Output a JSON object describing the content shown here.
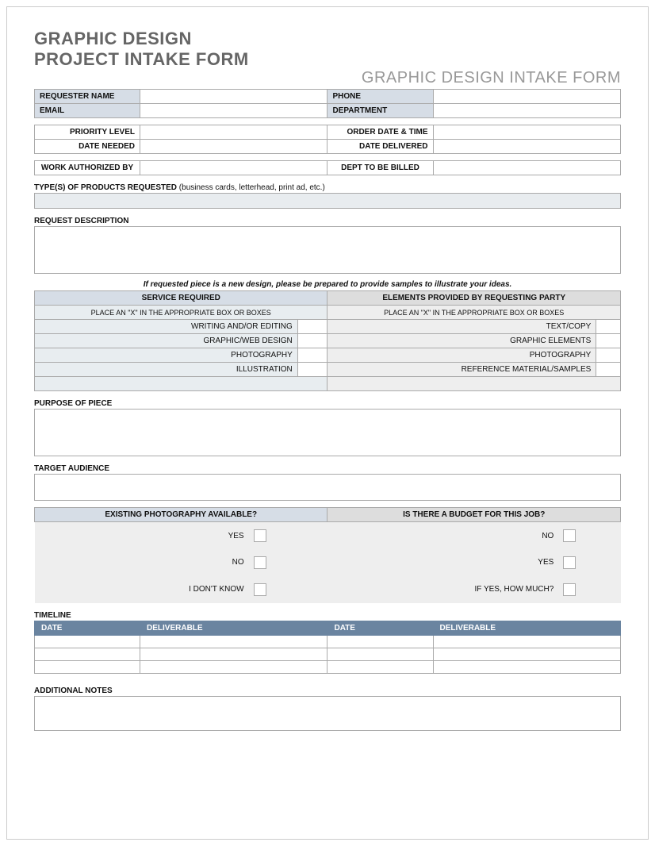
{
  "title_line1": "GRAPHIC DESIGN",
  "title_line2": "PROJECT INTAKE FORM",
  "header_right": "GRAPHIC DESIGN INTAKE FORM",
  "fields": {
    "requester_name": "REQUESTER NAME",
    "phone": "PHONE",
    "email": "EMAIL",
    "department": "DEPARTMENT",
    "priority_level": "PRIORITY LEVEL",
    "order_date_time": "ORDER DATE & TIME",
    "date_needed": "DATE NEEDED",
    "date_delivered": "DATE DELIVERED",
    "work_authorized_by": "WORK AUTHORIZED BY",
    "dept_to_be_billed": "DEPT TO BE BILLED"
  },
  "products": {
    "label": "TYPE(S) OF PRODUCTS REQUESTED",
    "hint": "(business cards, letterhead, print ad, etc.)"
  },
  "request_description": "REQUEST DESCRIPTION",
  "note": "If requested piece is a new design, please be prepared to provide samples to illustrate your ideas.",
  "service": {
    "header_left": "SERVICE REQUIRED",
    "header_right": "ELEMENTS PROVIDED BY REQUESTING PARTY",
    "instruction": "PLACE AN \"X\" IN THE APPROPRIATE BOX OR BOXES",
    "left_items": [
      "WRITING AND/OR EDITING",
      "GRAPHIC/WEB DESIGN",
      "PHOTOGRAPHY",
      "ILLUSTRATION"
    ],
    "right_items": [
      "TEXT/COPY",
      "GRAPHIC ELEMENTS",
      "PHOTOGRAPHY",
      "REFERENCE MATERIAL/SAMPLES"
    ]
  },
  "purpose": "PURPOSE OF PIECE",
  "target_audience": "TARGET AUDIENCE",
  "questions": {
    "photo_header": "EXISTING PHOTOGRAPHY AVAILABLE?",
    "budget_header": "IS THERE A BUDGET FOR THIS JOB?",
    "photo_opts": [
      "YES",
      "NO",
      "I DON'T KNOW"
    ],
    "budget_opts": [
      "NO",
      "YES",
      "IF YES, HOW MUCH?"
    ]
  },
  "timeline": {
    "label": "TIMELINE",
    "cols": [
      "DATE",
      "DELIVERABLE",
      "DATE",
      "DELIVERABLE"
    ]
  },
  "additional_notes": "ADDITIONAL NOTES"
}
